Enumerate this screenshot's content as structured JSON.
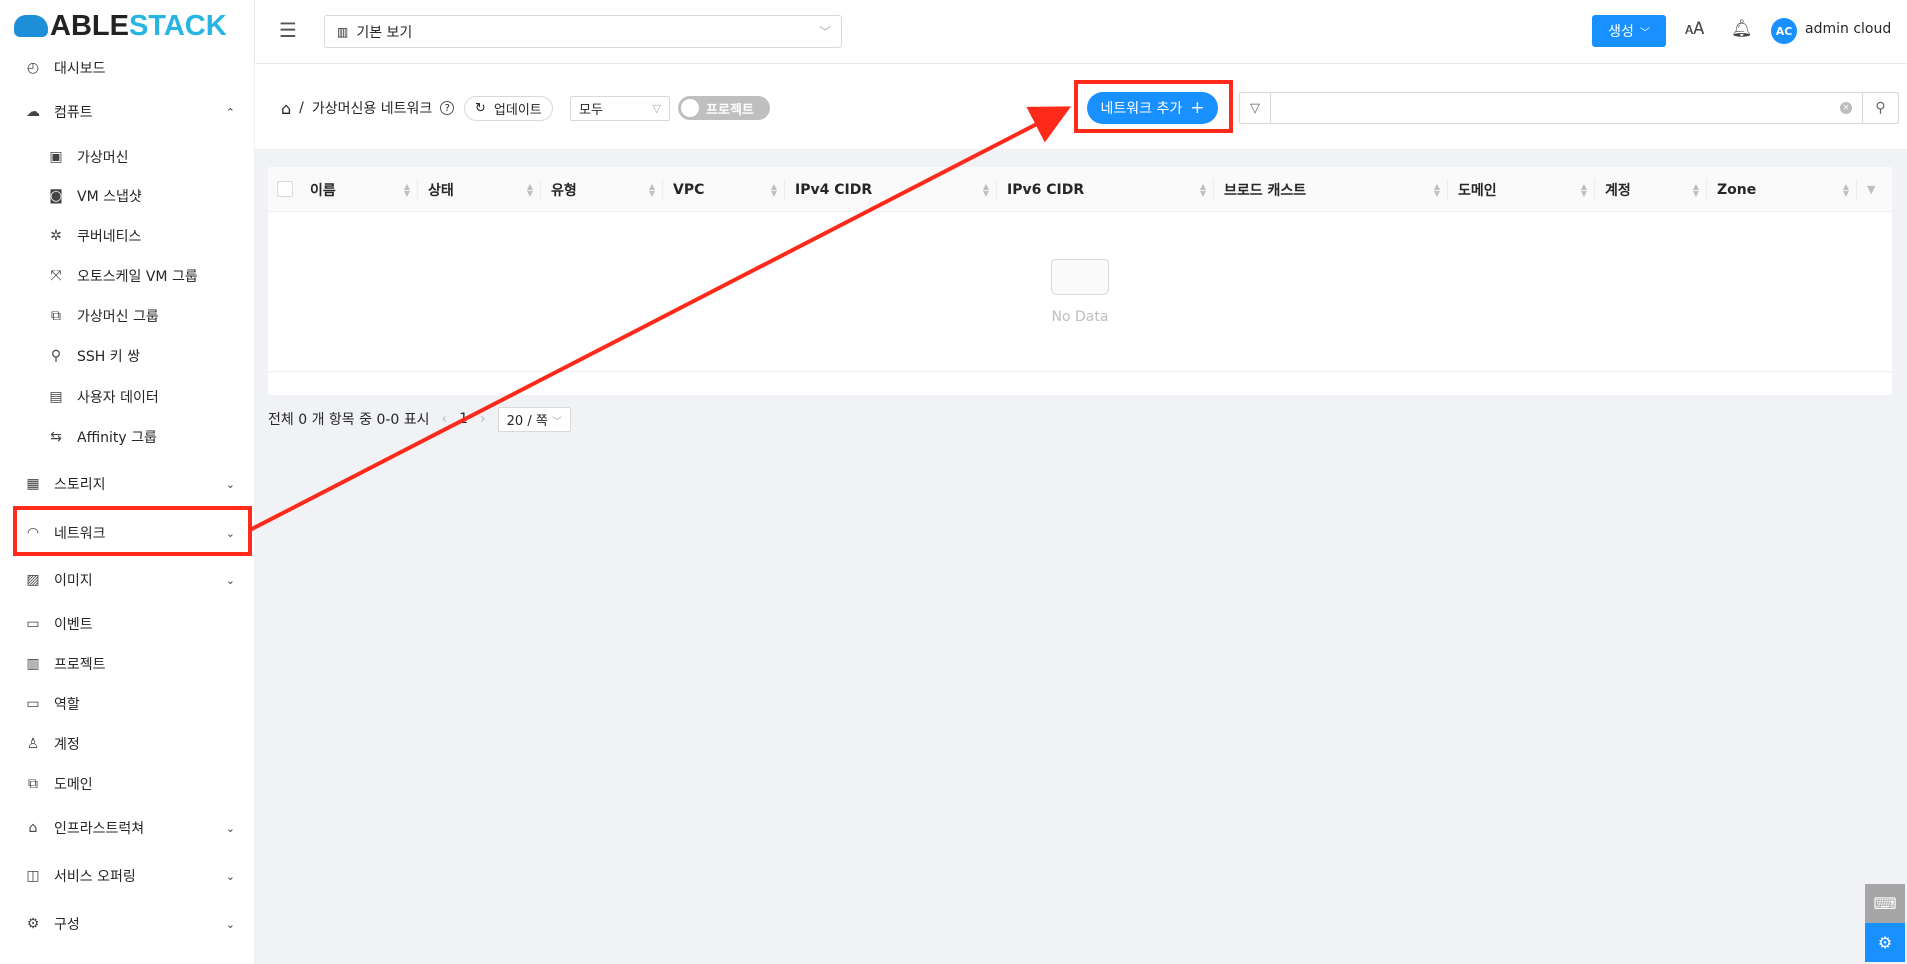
{
  "brand": {
    "logo_left": "ABLE",
    "logo_right": "STACK"
  },
  "sidebar": {
    "items": [
      {
        "label": "대시보드",
        "icon": "dashboard-icon"
      },
      {
        "label": "컴퓨트",
        "icon": "cloud-icon",
        "chevron": "up"
      },
      {
        "label": "가상머신",
        "icon": "vm-icon",
        "sub": true
      },
      {
        "label": "VM 스냅샷",
        "icon": "camera-icon",
        "sub": true
      },
      {
        "label": "쿠버네티스",
        "icon": "kubernetes-icon",
        "sub": true
      },
      {
        "label": "오토스케일 VM 그룹",
        "icon": "autoscale-icon",
        "sub": true
      },
      {
        "label": "가상머신 그룹",
        "icon": "cluster-icon",
        "sub": true
      },
      {
        "label": "SSH 키 쌍",
        "icon": "key-icon",
        "sub": true
      },
      {
        "label": "사용자 데이터",
        "icon": "document-icon",
        "sub": true
      },
      {
        "label": "Affinity 그룹",
        "icon": "swap-icon",
        "sub": true
      },
      {
        "label": "스토리지",
        "icon": "database-icon",
        "chevron": "down"
      },
      {
        "label": "네트워크",
        "icon": "wifi-icon",
        "chevron": "down"
      },
      {
        "label": "이미지",
        "icon": "picture-icon",
        "chevron": "down"
      },
      {
        "label": "이벤트",
        "icon": "calendar-icon"
      },
      {
        "label": "프로젝트",
        "icon": "project-icon"
      },
      {
        "label": "역할",
        "icon": "idcard-icon"
      },
      {
        "label": "계정",
        "icon": "user-icon"
      },
      {
        "label": "도메인",
        "icon": "block-icon"
      },
      {
        "label": "인프라스트럭쳐",
        "icon": "bank-icon",
        "chevron": "down"
      },
      {
        "label": "서비스 오퍼링",
        "icon": "shopping-icon",
        "chevron": "down"
      },
      {
        "label": "구성",
        "icon": "setting-icon",
        "chevron": "down"
      }
    ]
  },
  "header": {
    "view_select": "기본 보기",
    "create_label": "생성",
    "avatar_initials": "AC",
    "username": "admin cloud"
  },
  "toolbar": {
    "breadcrumb": "가상머신용 네트워크",
    "refresh_label": "업데이트",
    "filter_value": "모두",
    "project_toggle": "프로젝트",
    "add_network_label": "네트워크 추가",
    "search_value": ""
  },
  "table": {
    "columns": [
      "이름",
      "상태",
      "유형",
      "VPC",
      "IPv4 CIDR",
      "IPv6 CIDR",
      "브로드 캐스트",
      "도메인",
      "계정",
      "Zone"
    ],
    "empty_text": "No Data"
  },
  "pager": {
    "summary": "전체 0 개 항목 중 0-0 표시",
    "page": "1",
    "page_size": "20 / 쪽"
  },
  "colors": {
    "primary": "#1890ff",
    "annotation": "#ff2a1a"
  }
}
